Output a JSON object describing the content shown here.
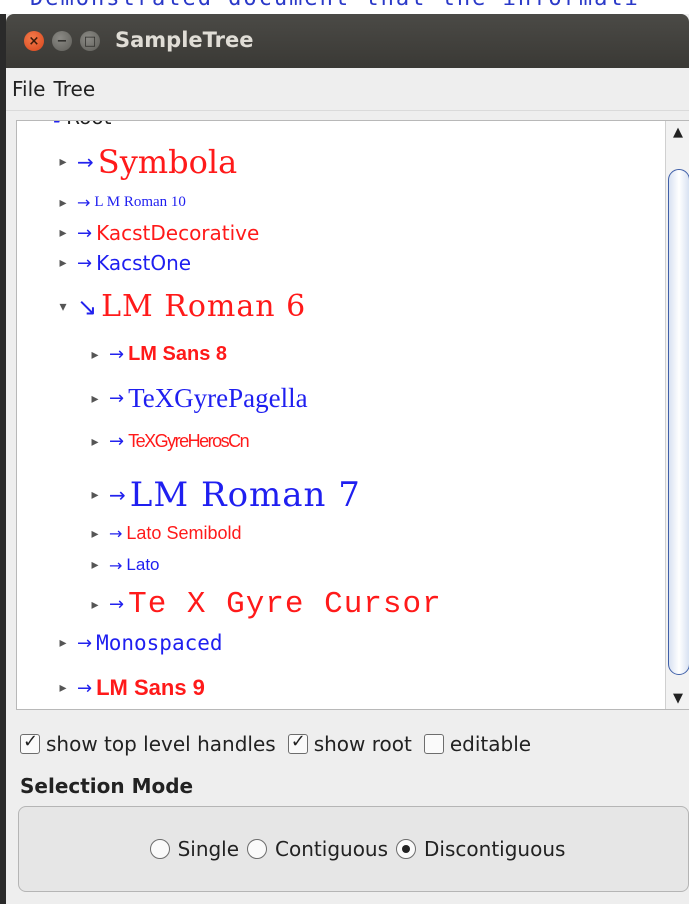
{
  "background_text": "Demonstrated document that the informati",
  "window": {
    "title": "SampleTree",
    "buttons": {
      "close": "×",
      "minimize": "−",
      "maximize": "□"
    }
  },
  "menu": [
    "File",
    "Tree"
  ],
  "tree": {
    "root_label": "Root",
    "toggle_collapsed": "▸",
    "toggle_expanded": "▾",
    "arrow_collapsed": "→",
    "arrow_expanded": "↘",
    "nodes": [
      {
        "label": "Symbola",
        "color": "#ff1a1a",
        "expanded": false
      },
      {
        "label": "L M Roman 10",
        "color": "#1f1ff0",
        "expanded": false
      },
      {
        "label": "KacstDecorative",
        "color": "#ff1a1a",
        "expanded": false
      },
      {
        "label": "KacstOne",
        "color": "#1f1ff0",
        "expanded": false
      },
      {
        "label": "LM Roman 6",
        "color": "#ff1a1a",
        "expanded": true
      },
      {
        "label": "LM Sans 8",
        "color": "#ff1a1a",
        "expanded": false
      },
      {
        "label": "TeXGyrePagella",
        "color": "#1f1ff0",
        "expanded": false
      },
      {
        "label": "TeXGyreHerosCn",
        "color": "#ff1a1a",
        "expanded": false
      },
      {
        "label": "LM Roman 7",
        "color": "#1f1ff0",
        "expanded": false
      },
      {
        "label": "Lato Semibold",
        "color": "#ff1a1a",
        "expanded": false
      },
      {
        "label": "Lato",
        "color": "#1f1ff0",
        "expanded": false
      },
      {
        "label": "Te X Gyre Cursor",
        "color": "#ff1a1a",
        "expanded": false
      },
      {
        "label": "Monospaced",
        "color": "#1f1ff0",
        "expanded": false
      },
      {
        "label": "LM Sans 9",
        "color": "#ff1a1a",
        "expanded": false
      }
    ]
  },
  "scrollbar": {
    "up": "▲",
    "down": "▼"
  },
  "options": {
    "show_handles": {
      "label": "show top level handles",
      "checked": true
    },
    "show_root": {
      "label": "show root",
      "checked": true
    },
    "editable": {
      "label": "editable",
      "checked": false
    }
  },
  "selection_mode": {
    "title": "Selection Mode",
    "options": [
      {
        "label": "Single",
        "selected": false
      },
      {
        "label": "Contiguous",
        "selected": false
      },
      {
        "label": "Discontiguous",
        "selected": true
      }
    ]
  }
}
